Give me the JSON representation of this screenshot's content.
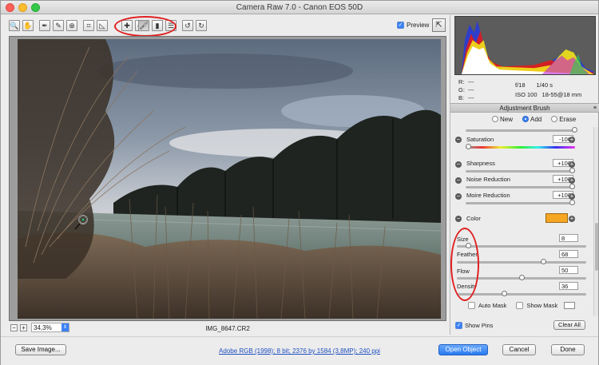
{
  "window": {
    "title": "Camera Raw 7.0  -  Canon EOS 50D"
  },
  "toolbar": {
    "tools": [
      {
        "name": "zoom-tool-icon",
        "glyph": "🔍"
      },
      {
        "name": "hand-tool-icon",
        "glyph": "✋"
      },
      {
        "name": "white-balance-tool-icon",
        "glyph": "✒"
      },
      {
        "name": "color-sampler-tool-icon",
        "glyph": "✎"
      },
      {
        "name": "targeted-adjustment-tool-icon",
        "glyph": "⊕"
      },
      {
        "name": "crop-tool-icon",
        "glyph": "⌗"
      },
      {
        "name": "straighten-tool-icon",
        "glyph": "◺"
      },
      {
        "name": "spot-removal-tool-icon",
        "glyph": "✚"
      },
      {
        "name": "red-eye-tool-icon",
        "glyph": "◉"
      },
      {
        "name": "adjustment-brush-tool-icon",
        "glyph": "🖌"
      },
      {
        "name": "graduated-filter-tool-icon",
        "glyph": "▮"
      },
      {
        "name": "preferences-icon",
        "glyph": "☰"
      },
      {
        "name": "rotate-left-icon",
        "glyph": "↺"
      },
      {
        "name": "rotate-right-icon",
        "glyph": "↻"
      }
    ],
    "preview_label": "Preview",
    "preview_checked": true
  },
  "canvas": {
    "zoom_value": "34,3%",
    "filename": "IMG_8647.CR2",
    "zoom_out_glyph": "−",
    "zoom_in_glyph": "+"
  },
  "readout": {
    "r_label": "R:",
    "g_label": "G:",
    "b_label": "B:",
    "r_value": "---",
    "g_value": "---",
    "b_value": "---",
    "aperture": "f/18",
    "shutter": "1/40 s",
    "iso": "ISO 100",
    "lens": "18-55@18 mm"
  },
  "panel": {
    "title": "Adjustment Brush",
    "modes": [
      "New",
      "Add",
      "Erase"
    ],
    "selected_mode": "Add",
    "adjustments": [
      {
        "label": "Saturation",
        "value": "-100",
        "fraction": 0.0
      },
      {
        "label": "Sharpness",
        "value": "+100",
        "fraction": 1.0
      },
      {
        "label": "Noise Reduction",
        "value": "+100",
        "fraction": 1.0
      },
      {
        "label": "Moire Reduction",
        "value": "+100",
        "fraction": 1.0
      }
    ],
    "color_label": "Color",
    "color_swatch": "#f5a623",
    "brush": [
      {
        "label": "Size",
        "value": "8",
        "fraction": 0.07
      },
      {
        "label": "Feather",
        "value": "68",
        "fraction": 0.68
      },
      {
        "label": "Flow",
        "value": "50",
        "fraction": 0.5
      },
      {
        "label": "Density",
        "value": "36",
        "fraction": 0.36
      }
    ],
    "auto_mask_label": "Auto Mask",
    "auto_mask_checked": false,
    "show_mask_label": "Show Mask",
    "show_mask_checked": false,
    "show_pins_label": "Show Pins",
    "show_pins_checked": true,
    "clear_all_label": "Clear All"
  },
  "bottom": {
    "save_image_label": "Save Image...",
    "workflow_text": "Adobe RGB (1998); 8 bit; 2376 by 1584 (3,8MP); 240 ppi",
    "open_object_label": "Open Object",
    "cancel_label": "Cancel",
    "done_label": "Done"
  },
  "colors": {
    "annotation_red": "#e02020",
    "accent_blue": "#3b82f6"
  }
}
